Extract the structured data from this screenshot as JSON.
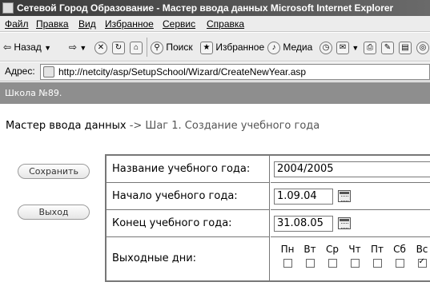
{
  "window": {
    "title": "Сетевой Город Образование - Мастер ввода данных Microsoft Internet Explorer"
  },
  "menu": {
    "items": [
      "Файл",
      "Правка",
      "Вид",
      "Избранное",
      "Сервис",
      "Справка"
    ]
  },
  "toolbar": {
    "back_label": "Назад",
    "search_label": "Поиск",
    "favorites_label": "Избранное",
    "media_label": "Медиа"
  },
  "address": {
    "label": "Адрес:",
    "url": "http://netcity/asp/SetupSchool/Wizard/CreateNewYear.asp"
  },
  "school": {
    "name": "Школа №89."
  },
  "wizard": {
    "title": "Мастер ввода данных",
    "arrow": " -> ",
    "step": "Шаг 1. Создание учебного года"
  },
  "buttons": {
    "save_label": "Сохранить",
    "exit_label": "Выход"
  },
  "form": {
    "year_name": {
      "label": "Название учебного года:",
      "value": "2004/2005"
    },
    "year_start": {
      "label": "Начало учебного года:",
      "value": "1.09.04"
    },
    "year_end": {
      "label": "Конец учебного года:",
      "value": "31.08.05"
    },
    "days_off": {
      "label": "Выходные дни:",
      "days": [
        {
          "name": "Пн",
          "checked": false
        },
        {
          "name": "Вт",
          "checked": false
        },
        {
          "name": "Ср",
          "checked": false
        },
        {
          "name": "Чт",
          "checked": false
        },
        {
          "name": "Пт",
          "checked": false
        },
        {
          "name": "Сб",
          "checked": false
        },
        {
          "name": "Вс",
          "checked": true
        }
      ]
    }
  }
}
